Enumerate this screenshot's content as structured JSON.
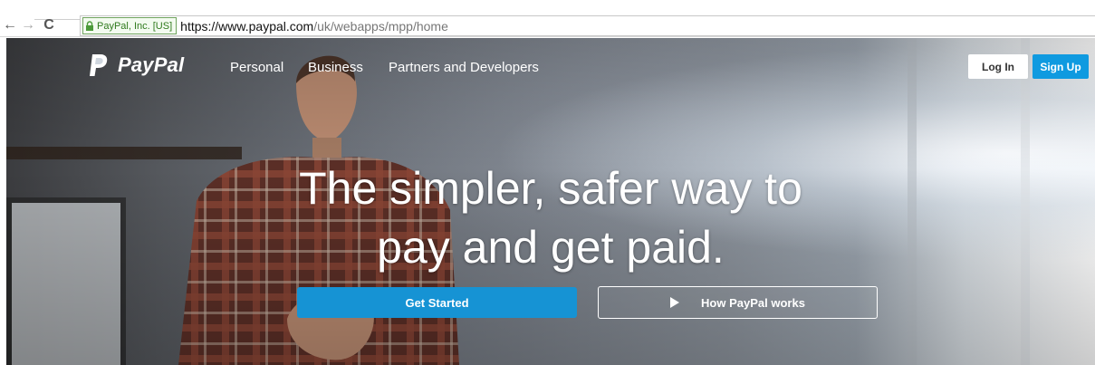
{
  "browser": {
    "back_glyph": "←",
    "forward_glyph": "→",
    "reload_glyph": "C",
    "ev_certificate": "PayPal, Inc. [US]",
    "url_host": "https://www.paypal.com",
    "url_path": "/uk/webapps/mpp/home",
    "icons": [
      "back-arrow-icon",
      "forward-arrow-icon",
      "reload-icon",
      "lock-icon"
    ]
  },
  "site": {
    "logo_text": "PayPal",
    "nav": [
      "Personal",
      "Business",
      "Partners and Developers"
    ],
    "login_label": "Log In",
    "signup_label": "Sign Up",
    "headline_line1": "The simpler, safer way to",
    "headline_line2": "pay and get paid.",
    "get_started_label": "Get Started",
    "how_label": "How PayPal works",
    "colors": {
      "accent": "#1693d4",
      "signup": "#0f9ae0",
      "text": "#ffffff"
    }
  }
}
